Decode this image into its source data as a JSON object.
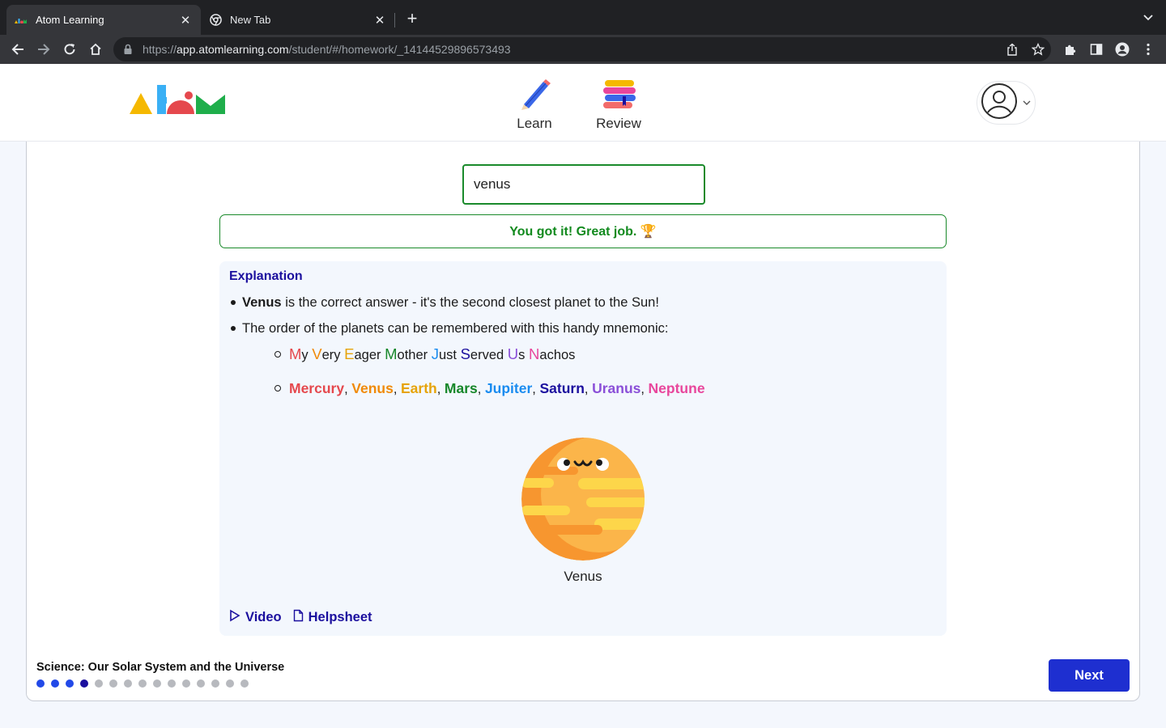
{
  "browser": {
    "tabs": [
      {
        "title": "Atom Learning",
        "active": true
      },
      {
        "title": "New Tab",
        "active": false
      }
    ],
    "url": {
      "scheme": "https://",
      "host": "app.atomlearning.com",
      "path": "/student/#/homework/_14144529896573493"
    }
  },
  "header": {
    "nav": [
      {
        "label": "Learn",
        "icon": "pencil-icon"
      },
      {
        "label": "Review",
        "icon": "books-icon"
      }
    ]
  },
  "question": {
    "answer_value": "venus",
    "feedback": "You got it! Great job. 🏆"
  },
  "explanation": {
    "heading": "Explanation",
    "bullet1_bold": "Venus",
    "bullet1_rest": " is the correct answer - it's the second closest planet to the Sun!",
    "bullet2": "The order of the planets can be remembered with this handy mnemonic:",
    "mnemonic": [
      {
        "cap": "M",
        "rest": "y",
        "color": "#e5484d"
      },
      {
        "cap": "V",
        "rest": "ery",
        "color": "#f08a0a"
      },
      {
        "cap": "E",
        "rest": "ager",
        "color": "#e6a30a"
      },
      {
        "cap": "M",
        "rest": "other",
        "color": "#17872a"
      },
      {
        "cap": "J",
        "rest": "ust",
        "color": "#1a8cf0"
      },
      {
        "cap": "S",
        "rest": "erved",
        "color": "#1b0f9e"
      },
      {
        "cap": "U",
        "rest": "s",
        "color": "#8a4fd8"
      },
      {
        "cap": "N",
        "rest": "achos",
        "color": "#e8469c"
      }
    ],
    "planets": [
      {
        "name": "Mercury",
        "color": "#e5484d"
      },
      {
        "name": "Venus",
        "color": "#f08a0a"
      },
      {
        "name": "Earth",
        "color": "#e6a30a"
      },
      {
        "name": "Mars",
        "color": "#17872a"
      },
      {
        "name": "Jupiter",
        "color": "#1a8cf0"
      },
      {
        "name": "Saturn",
        "color": "#1b0f9e"
      },
      {
        "name": "Uranus",
        "color": "#8a4fd8"
      },
      {
        "name": "Neptune",
        "color": "#e8469c"
      }
    ],
    "image_caption": "Venus",
    "video_label": "Video",
    "helpsheet_label": "Helpsheet"
  },
  "footer": {
    "topic": "Science: Our Solar System and the Universe",
    "progress_total": 15,
    "progress_done": 3,
    "progress_current_index": 3,
    "next_label": "Next"
  },
  "colors": {
    "accent": "#1e2fd0",
    "success": "#128a1e",
    "heading": "#1b0f9e",
    "dot_done": "#2249e8",
    "dot_current": "#1b0f9e",
    "dot_todo": "#b7b9be"
  }
}
